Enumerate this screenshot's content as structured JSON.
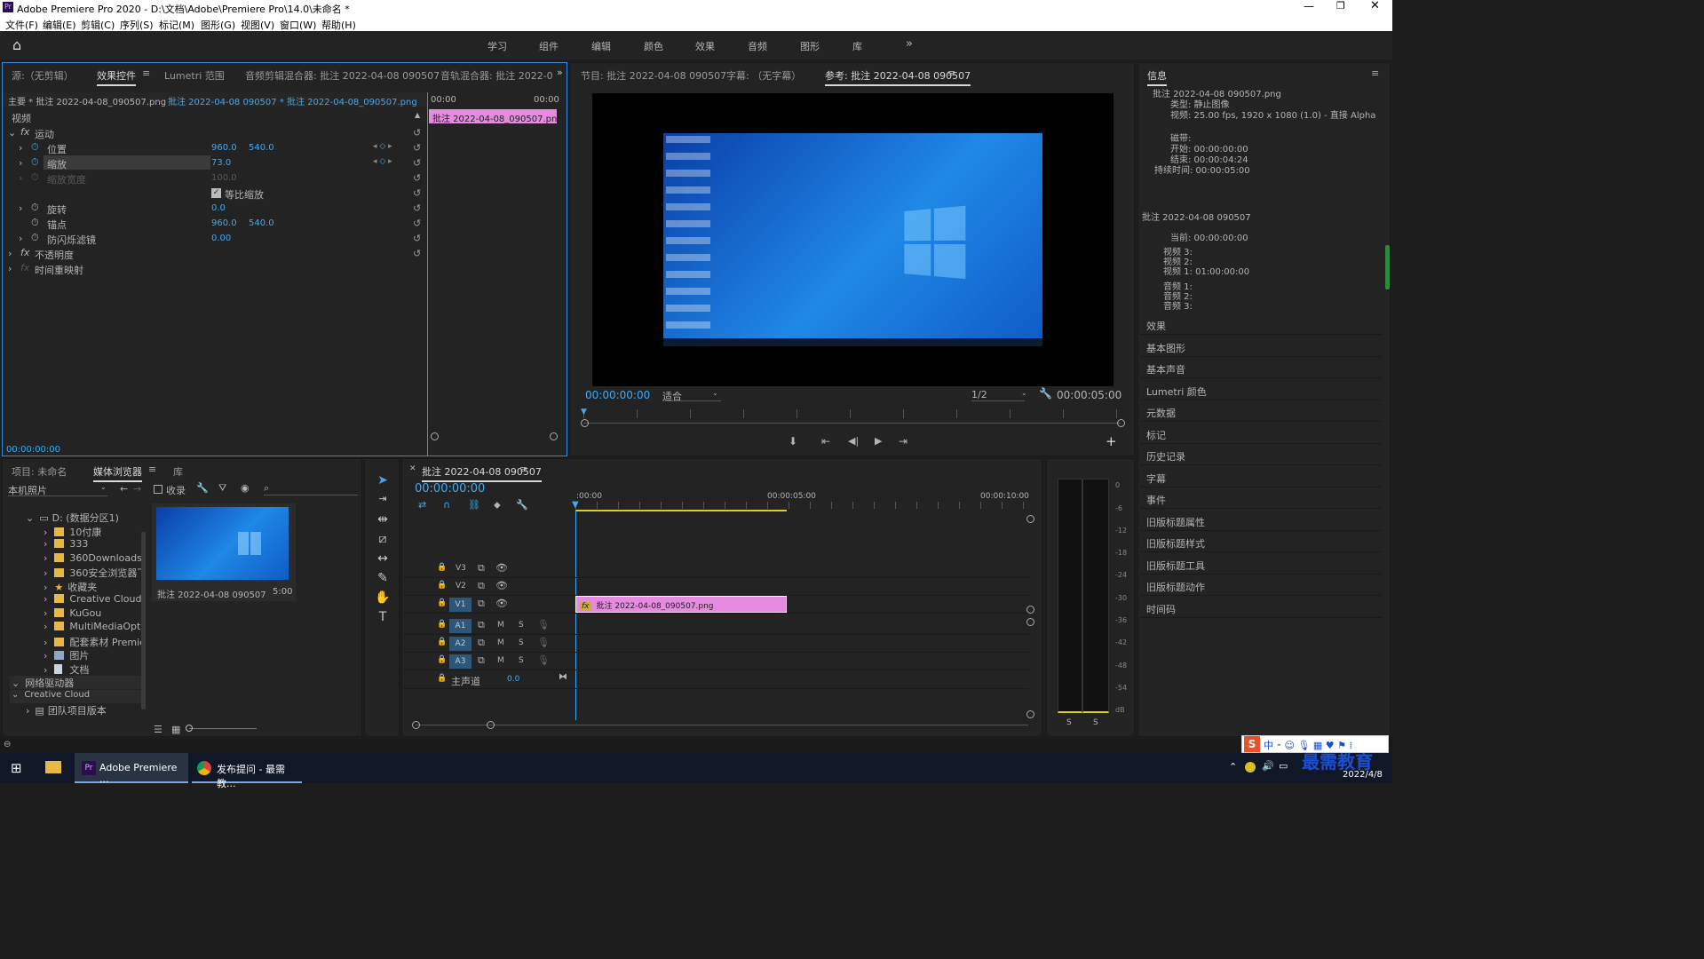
{
  "window": {
    "title": "Adobe Premiere Pro 2020 - D:\\文档\\Adobe\\Premiere Pro\\14.0\\未命名 *"
  },
  "menu": [
    "文件(F)",
    "编辑(E)",
    "剪辑(C)",
    "序列(S)",
    "标记(M)",
    "图形(G)",
    "视图(V)",
    "窗口(W)",
    "帮助(H)"
  ],
  "workspaces": [
    "学习",
    "组件",
    "编辑",
    "颜色",
    "效果",
    "音频",
    "图形",
    "库"
  ],
  "effects_panel": {
    "tabs": [
      "源:（无剪辑）",
      "效果控件",
      "Lumetri 范围",
      "音频剪辑混合器: 批注 2022-04-08 090507",
      "音轨混合器: 批注 2022-0"
    ],
    "master": "主要 * 批注 2022-04-08_090507.png",
    "clip_path": "批注 2022-04-08 090507 * 批注 2022-04-08_090507.png",
    "ruler_start": "00:00",
    "ruler_end": "00:00",
    "clip_bar": "批注 2022-04-08_090507.png",
    "section": "视频",
    "motion": "运动",
    "props": [
      {
        "label": "位置",
        "v1": "960.0",
        "v2": "540.0"
      },
      {
        "label": "缩放",
        "v1": "73.0",
        "v2": ""
      },
      {
        "label": "缩放宽度",
        "v1": "100.0",
        "v2": ""
      },
      {
        "label": "等比缩放",
        "v1": "",
        "v2": ""
      },
      {
        "label": "旋转",
        "v1": "0.0",
        "v2": ""
      },
      {
        "label": "锚点",
        "v1": "960.0",
        "v2": "540.0"
      },
      {
        "label": "防闪烁滤镜",
        "v1": "0.00",
        "v2": ""
      }
    ],
    "opacity": "不透明度",
    "timeremap": "时间重映射",
    "timecode": "00:00:00:00"
  },
  "monitor": {
    "tabs": [
      "节目: 批注 2022-04-08 090507",
      "字幕: （无字幕）",
      "参考: 批注 2022-04-08 090507"
    ],
    "timecode": "00:00:00:00",
    "fit": "适合",
    "res": "1/2",
    "duration": "00:00:05:00"
  },
  "info": {
    "title": "信息",
    "file": "批注 2022-04-08 090507.png",
    "type": "类型: 静止图像",
    "video": "视频: 25.00 fps, 1920 x 1080 (1.0) - 直接 Alpha",
    "tape": "磁带:",
    "start": "开始: 00:00:00:00",
    "end": "结束: 00:00:04:24",
    "duration": "持续时间: 00:00:05:00",
    "seq": "批注 2022-04-08 090507",
    "current": "当前: 00:00:00:00",
    "v3": "视频 3:",
    "v2": "视频 2:",
    "v1": "视频 1: 01:00:00:00",
    "a1": "音频 1:",
    "a2": "音频 2:",
    "a3": "音频 3:"
  },
  "right_items": [
    "效果",
    "基本图形",
    "基本声音",
    "Lumetri 颜色",
    "元数据",
    "标记",
    "历史记录",
    "字幕",
    "事件",
    "旧版标题属性",
    "旧版标题样式",
    "旧版标题工具",
    "旧版标题动作",
    "时间码"
  ],
  "project": {
    "tabs": [
      "项目: 未命名",
      "媒体浏览器",
      "库"
    ],
    "location": "本机照片",
    "collect": "收录",
    "drive": "D: (数据分区1)",
    "folders": [
      "10付康",
      "333",
      "360Downloads",
      "360安全浏览器下",
      "收藏夹",
      "Creative Cloud File",
      "KuGou",
      "MultiMediaOpt",
      "配套素材 Premier",
      "图片",
      "文档"
    ],
    "network": "网络驱动器",
    "cc": "Creative Cloud",
    "team": "团队项目版本",
    "thumb_name": "批注 2022-04-08 090507",
    "thumb_dur": "5:00"
  },
  "timeline": {
    "tab": "批注 2022-04-08 090507",
    "timecode": "00:00:00:00",
    "ticks": [
      ":00:00",
      "00:00:05:00",
      "00:00:10:00"
    ],
    "video_tracks": [
      "V3",
      "V2",
      "V1"
    ],
    "audio_tracks": [
      "A1",
      "A2",
      "A3"
    ],
    "master": "主声道",
    "master_val": "0.0",
    "clip": "批注 2022-04-08_090507.png"
  },
  "meter": {
    "labels": [
      "0",
      "-6",
      "-12",
      "-18",
      "-24",
      "-30",
      "-36",
      "-42",
      "-48",
      "-54",
      "dB"
    ],
    "s": "S"
  },
  "taskbar": {
    "premiere": "Adobe Premiere ...",
    "chrome": "发布提问 - 最需教...",
    "date": "2022/4/8",
    "watermark": "最需教育"
  }
}
